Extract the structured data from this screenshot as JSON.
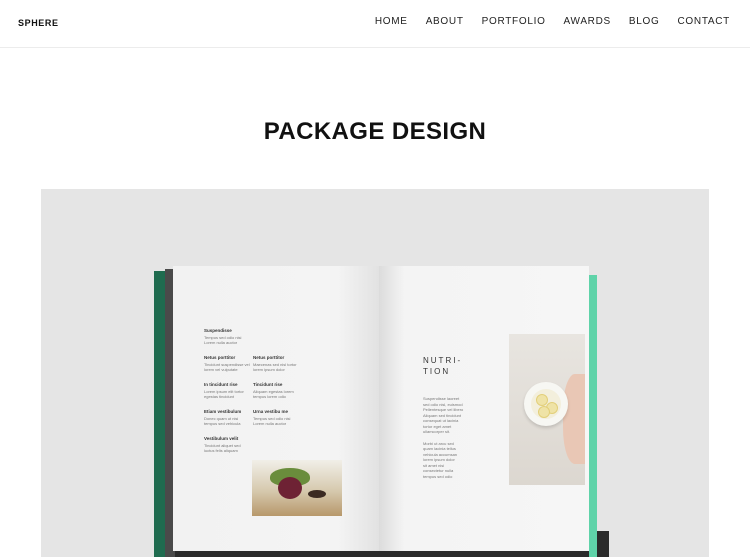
{
  "header": {
    "logo": "SPHERE",
    "nav": [
      "HOME",
      "ABOUT",
      "PORTFOLIO",
      "AWARDS",
      "BLOG",
      "CONTACT"
    ]
  },
  "page": {
    "title": "PACKAGE DESIGN"
  },
  "book": {
    "left_page": {
      "col1": [
        {
          "heading": "Suspendisse",
          "lines": [
            "Tempus sed odio nisi",
            "Lorem nulla auctor"
          ]
        },
        {
          "heading": "Netus porttitor",
          "lines": [
            "Tincidunt suspendisse vel",
            "lorem vel vulputate"
          ]
        },
        {
          "heading": "In tincidunt rise",
          "lines": [
            "Lorem ipsum elit tortor",
            "egestas tincidunt"
          ]
        },
        {
          "heading": "Etiam vestibulum",
          "lines": [
            "Donec quam ut nisi",
            "tempus sed vehicula"
          ]
        },
        {
          "heading": "Vestibulum velit",
          "lines": [
            "Tincidunt aliquet sed",
            "luctus felis aliquam"
          ]
        }
      ],
      "col2": [
        {
          "heading": "Netus porttitor",
          "lines": [
            "Maecenas sed nisl tortor",
            "lorem ipsum dolor"
          ]
        },
        {
          "heading": "Tincidunt rise",
          "lines": [
            "Aliquam egestas lorem",
            "tempus lorem odio"
          ]
        },
        {
          "heading": "Urna vestibu me",
          "lines": [
            "Tempus sed odio nisi",
            "Lorem nulla auctor"
          ]
        }
      ]
    },
    "right_page": {
      "heading_line1": "NUTRI-",
      "heading_line2": "TION",
      "body_lines": [
        "Suspendisse laoreet",
        "sed odio nisl, euismod",
        "Pellentesque vel libero",
        "Aliquam sed tincidunt",
        "consequat ut lacinia",
        "tortor eget amet",
        "ullamcorper sit.",
        "Morbi ut arcu sed",
        "quam lacinia tellus",
        "vehicula accumsan",
        "lorem ipsum dolor",
        "sit amet nisi",
        "consectetur nulla",
        "tempus sed odio"
      ]
    }
  },
  "colors": {
    "hero_background": "#e5e5e5",
    "cover_dark_green": "#1f6b4f",
    "cover_mint": "#5fd3a9"
  }
}
